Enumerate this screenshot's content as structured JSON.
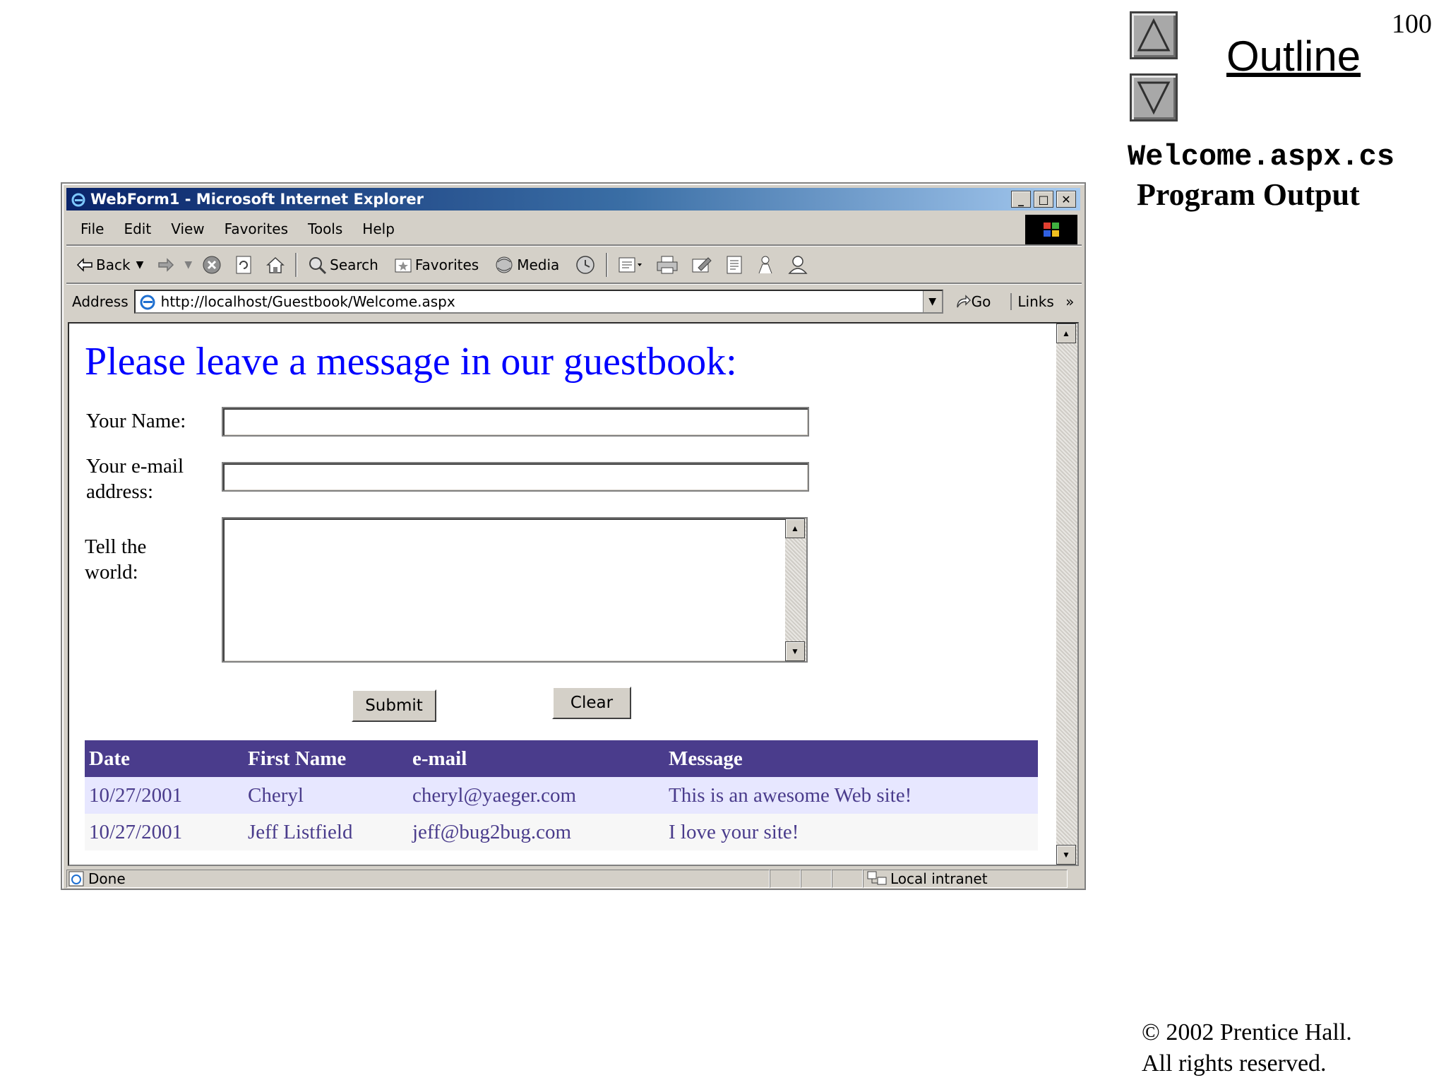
{
  "slide": {
    "page_number": "100",
    "outline_label": "Outline",
    "file_name": "Welcome.aspx.cs",
    "subtitle": "Program Output",
    "copyright_line1": "© 2002 Prentice Hall.",
    "copyright_line2": "All rights reserved."
  },
  "browser": {
    "title": "WebForm1 - Microsoft Internet Explorer",
    "menu": [
      "File",
      "Edit",
      "View",
      "Favorites",
      "Tools",
      "Help"
    ],
    "toolbar": {
      "back": "Back",
      "search": "Search",
      "favorites": "Favorites",
      "media": "Media"
    },
    "address_label": "Address",
    "url": "http://localhost/Guestbook/Welcome.aspx",
    "go": "Go",
    "links": "Links",
    "status_text": "Done",
    "zone": "Local intranet"
  },
  "page": {
    "heading": "Please leave a message in our guestbook:",
    "name_label": "Your Name:",
    "email_label_1": "Your e-mail",
    "email_label_2": "address:",
    "message_label_1": "Tell the",
    "message_label_2": "world:",
    "name_value": "",
    "email_value": "",
    "message_value": "",
    "submit": "Submit",
    "clear": "Clear"
  },
  "guestbook": {
    "headers": [
      "Date",
      "First Name",
      "e-mail",
      "Message"
    ],
    "rows": [
      [
        "10/27/2001",
        "Cheryl",
        "cheryl@yaeger.com",
        "This is an awesome Web site!"
      ],
      [
        "10/27/2001",
        "Jeff Listfield",
        "jeff@bug2bug.com",
        "I love your site!"
      ]
    ]
  },
  "colors": {
    "heading": "#0000ff",
    "grid_header": "#4a3c8c",
    "grid_row_odd": "#e7e7ff",
    "grid_row_even": "#f7f7f7"
  }
}
